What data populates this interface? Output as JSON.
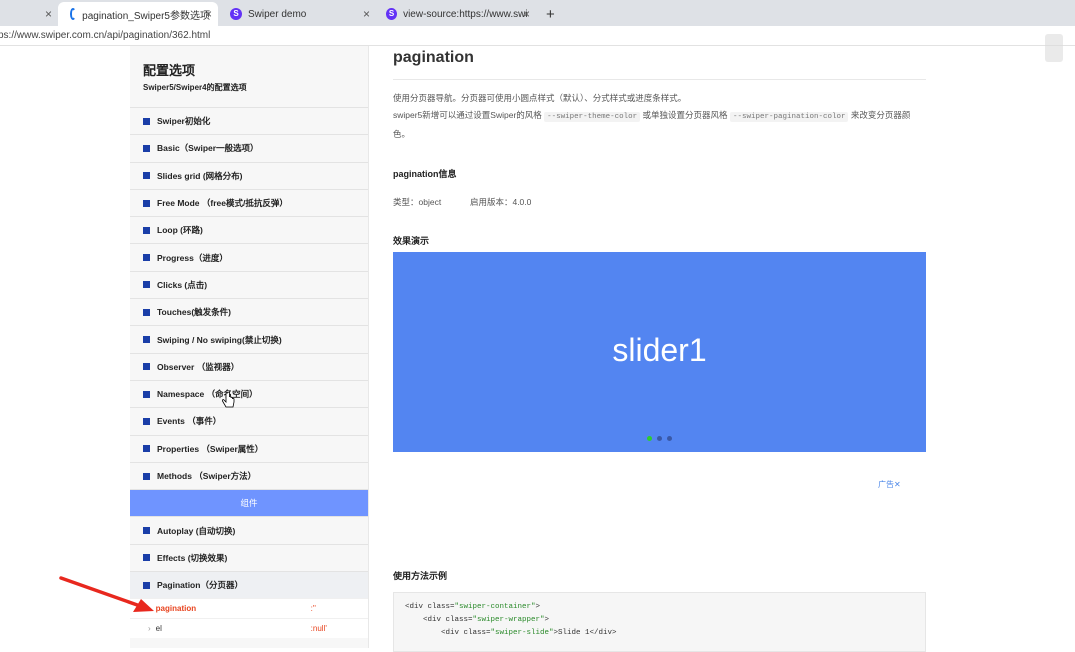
{
  "tabs": [
    {
      "label": "",
      "active": false
    },
    {
      "label": "pagination_Swiper5参数选项",
      "active": true
    },
    {
      "label": "Swiper demo",
      "active": false
    },
    {
      "label": "view-source:https://www.swipe",
      "active": false
    }
  ],
  "new_tab_icon": "plus-icon",
  "address": {
    "url": "ps://www.swiper.com.cn/api/pagination/362.html"
  },
  "sidebar": {
    "title": "配置选项",
    "subtitle": "Swiper5/Swiper4的配置选项",
    "items": [
      {
        "label": "Swiper初始化"
      },
      {
        "label": "Basic（Swiper一般选项）"
      },
      {
        "label": "Slides grid (网格分布)"
      },
      {
        "label": "Free Mode （free模式/抵抗反弹）"
      },
      {
        "label": "Loop (环路)"
      },
      {
        "label": "Progress（进度）"
      },
      {
        "label": "Clicks (点击)"
      },
      {
        "label": "Touches(触发条件)"
      },
      {
        "label": "Swiping / No swiping(禁止切换)"
      },
      {
        "label": "Observer （监视器）"
      },
      {
        "label": "Namespace （命名空间）"
      },
      {
        "label": "Events （事件）"
      },
      {
        "label": "Properties （Swiper属性）"
      },
      {
        "label": "Methods （Swiper方法）"
      }
    ],
    "section_label": "组件",
    "component_items": [
      {
        "label": "Autoplay (自动切换)"
      },
      {
        "label": "Effects (切换效果)"
      },
      {
        "label": "Pagination（分页器）"
      }
    ],
    "sub_items": [
      {
        "name": "pagination",
        "value": ":''"
      },
      {
        "name": "el",
        "value": ":null'"
      }
    ]
  },
  "main": {
    "title": "pagination",
    "desc_line1": "使用分页器导航。分页器可使用小圆点样式（默认）、分式样式或进度条样式。",
    "desc_line2_a": "swiper5新增可以通过设置Swiper的风格",
    "desc_code1": "--swiper-theme-color",
    "desc_line2_b": "或单独设置分页器风格",
    "desc_code2": "--swiper-pagination-color",
    "desc_line2_c": "来改变分页器颜色。",
    "info_heading": "pagination信息",
    "type_label": "类型：",
    "type_value": "object",
    "version_label": "启用版本：",
    "version_value": "4.0.0",
    "demo_heading": "效果演示",
    "demo_slide_text": "slider1",
    "demo_color": "#5385f1",
    "active_dot_color": "#2ecc2e",
    "ad_label": "广告",
    "usage_heading": "使用方法示例",
    "code_lines": [
      {
        "indent": 0,
        "open": "<div class=",
        "cls": "\"swiper-container\"",
        "close": ">"
      },
      {
        "indent": 1,
        "open": "<div class=",
        "cls": "\"swiper-wrapper\"",
        "close": ">"
      },
      {
        "indent": 2,
        "open": "<div class=",
        "cls": "\"swiper-slide\"",
        "close": ">Slide 1</div>"
      }
    ]
  }
}
